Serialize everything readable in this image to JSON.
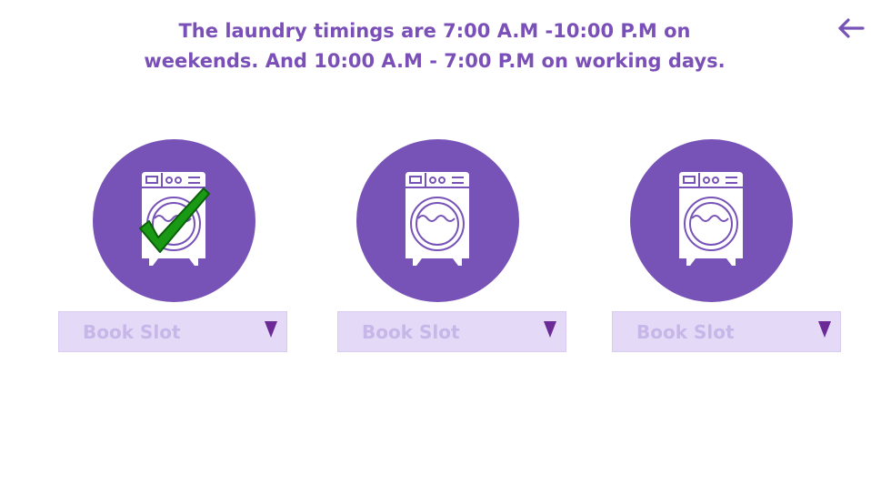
{
  "header": {
    "info_line_1": "The laundry timings are 7:00 A.M -10:00 P.M on",
    "info_line_2": "weekends. And 10:00 A.M - 7:00 P.M on working days.",
    "back_icon": "arrow-left-icon"
  },
  "machines": [
    {
      "booked": true,
      "icon": "washing-machine-icon",
      "check_icon": "checkmark-icon",
      "select_label": "Book Slot"
    },
    {
      "booked": false,
      "icon": "washing-machine-icon",
      "select_label": "Book Slot"
    },
    {
      "booked": false,
      "icon": "washing-machine-icon",
      "select_label": "Book Slot"
    }
  ],
  "colors": {
    "primary": "#7853b7",
    "select_background": "#e4daf8",
    "select_text": "#c6b7e8",
    "dropdown_arrow": "#6b2a95",
    "checkmark": "#1a9a14"
  }
}
